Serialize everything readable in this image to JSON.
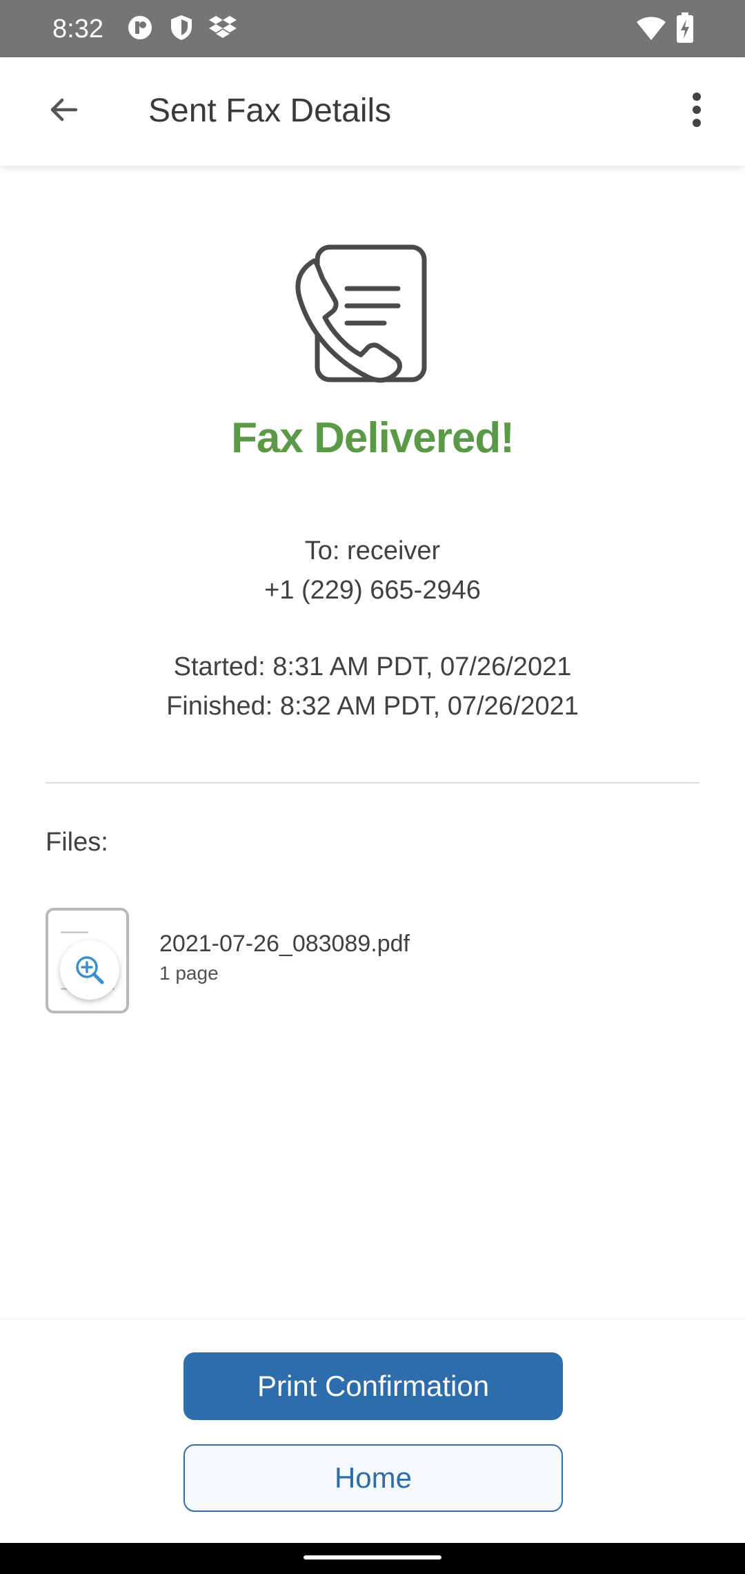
{
  "status_bar": {
    "time": "8:32",
    "left_icons": [
      "screen-record-icon",
      "shield-icon",
      "dropbox-icon"
    ],
    "right_icons": [
      "wifi-icon",
      "battery-charging-icon"
    ]
  },
  "app_bar": {
    "title": "Sent Fax Details",
    "back_icon": "arrow-back-icon",
    "menu_icon": "more-vert-icon"
  },
  "status": {
    "icon": "fax-phone-document-icon",
    "heading": "Fax Delivered!",
    "heading_color": "#5a9a47"
  },
  "recipient": {
    "to_line": "To: receiver",
    "phone": "+1 (229) 665-2946"
  },
  "timing": {
    "started": "Started: 8:31 AM PDT, 07/26/2021",
    "finished": "Finished: 8:32 AM PDT, 07/26/2021"
  },
  "files": {
    "label": "Files:",
    "items": [
      {
        "name": "2021-07-26_083089.pdf",
        "pages": "1 page",
        "icon": "zoom-in-icon"
      }
    ]
  },
  "actions": {
    "print_label": "Print Confirmation",
    "home_label": "Home",
    "accent_color": "#2e6dab"
  }
}
